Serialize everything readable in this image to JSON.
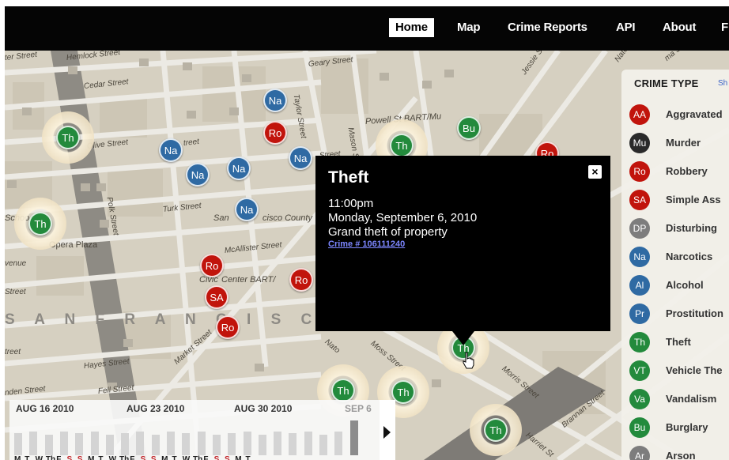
{
  "nav": {
    "items": [
      {
        "label": "Home",
        "active": true
      },
      {
        "label": "Map"
      },
      {
        "label": "Crime Reports"
      },
      {
        "label": "API"
      },
      {
        "label": "About"
      },
      {
        "label": "F"
      }
    ]
  },
  "map": {
    "streets": [
      "ter Street",
      "Hemlock Street",
      "Cedar Street",
      "Geary Street",
      "Taylor Street",
      "Mason Street",
      "Jessie St",
      "Olive Street",
      "treet",
      "Street",
      "Powell St BART/Mu",
      "Turk Street",
      "San",
      "cisco County",
      "Polk Street",
      "Schoo",
      "Opera Plaza",
      "venue",
      "McAllister Street",
      "Civic",
      "Center BART/",
      "Street",
      "Market Street",
      "treet",
      "Hayes Street",
      "nden Street",
      "Fell Street",
      "Nato",
      "Moss Street",
      "Morris Street",
      "Brannan Street",
      "Harriet St",
      "Natom",
      "ma St"
    ],
    "district": "S A N   F R A N C I S C",
    "markers": [
      {
        "code": "Na",
        "color": "Na"
      },
      {
        "code": "Ro",
        "color": "Ro"
      },
      {
        "code": "Th",
        "color": "Th"
      },
      {
        "code": "Na",
        "color": "Na"
      },
      {
        "code": "Na",
        "color": "Na"
      },
      {
        "code": "Na",
        "color": "Na"
      },
      {
        "code": "Na",
        "color": "Na"
      },
      {
        "code": "Th",
        "color": "Th"
      },
      {
        "code": "Bu",
        "color": "Bu"
      },
      {
        "code": "Ro",
        "color": "Ro"
      },
      {
        "code": "Th",
        "color": "Th"
      },
      {
        "code": "Na",
        "color": "Na"
      },
      {
        "code": "Ro",
        "color": "Ro"
      },
      {
        "code": "Ro",
        "color": "Ro"
      },
      {
        "code": "SA",
        "color": "SA"
      },
      {
        "code": "Ro",
        "color": "Ro"
      },
      {
        "code": "Th",
        "color": "Th"
      },
      {
        "code": "Th",
        "color": "Th"
      },
      {
        "code": "Th",
        "color": "Th"
      },
      {
        "code": "Th",
        "color": "Th"
      }
    ]
  },
  "popup": {
    "title": "Theft",
    "time": "11:00pm",
    "date": "Monday, September 6, 2010",
    "description": "Grand theft of property",
    "link": "Crime # 106111240",
    "close_icon": "×"
  },
  "legend": {
    "title": "CRIME TYPE",
    "link": "Sh",
    "items": [
      {
        "code": "AA",
        "label": "Aggravated",
        "color": "#c1140c"
      },
      {
        "code": "Mu",
        "label": "Murder",
        "color": "#2a2a2a"
      },
      {
        "code": "Ro",
        "label": "Robbery",
        "color": "#c1140c"
      },
      {
        "code": "SA",
        "label": "Simple Ass",
        "color": "#c1140c"
      },
      {
        "code": "DP",
        "label": "Disturbing",
        "color": "#7d7d7d"
      },
      {
        "code": "Na",
        "label": "Narcotics",
        "color": "#2f6aa3"
      },
      {
        "code": "Al",
        "label": "Alcohol",
        "color": "#2f6aa3"
      },
      {
        "code": "Pr",
        "label": "Prostitution",
        "color": "#2f6aa3"
      },
      {
        "code": "Th",
        "label": "Theft",
        "color": "#238a3c"
      },
      {
        "code": "VT",
        "label": "Vehicle The",
        "color": "#238a3c"
      },
      {
        "code": "Va",
        "label": "Vandalism",
        "color": "#238a3c"
      },
      {
        "code": "Bu",
        "label": "Burglary",
        "color": "#238a3c"
      },
      {
        "code": "Ar",
        "label": "Arson",
        "color": "#7d7d7d"
      }
    ]
  },
  "timeline": {
    "dates": [
      "AUG 16 2010",
      "AUG 23 2010",
      "AUG 30 2010",
      "SEP 6"
    ],
    "days": [
      "M",
      "T",
      "W",
      "Th",
      "F",
      "S",
      "S",
      "M",
      "T",
      "W",
      "Th",
      "F",
      "S",
      "S",
      "M",
      "T",
      "W",
      "Th",
      "F",
      "S",
      "S",
      "M",
      "T"
    ],
    "weekend_flags": [
      false,
      false,
      false,
      false,
      false,
      true,
      true,
      false,
      false,
      false,
      false,
      false,
      true,
      true,
      false,
      false,
      false,
      false,
      false,
      true,
      true,
      false,
      false
    ]
  }
}
